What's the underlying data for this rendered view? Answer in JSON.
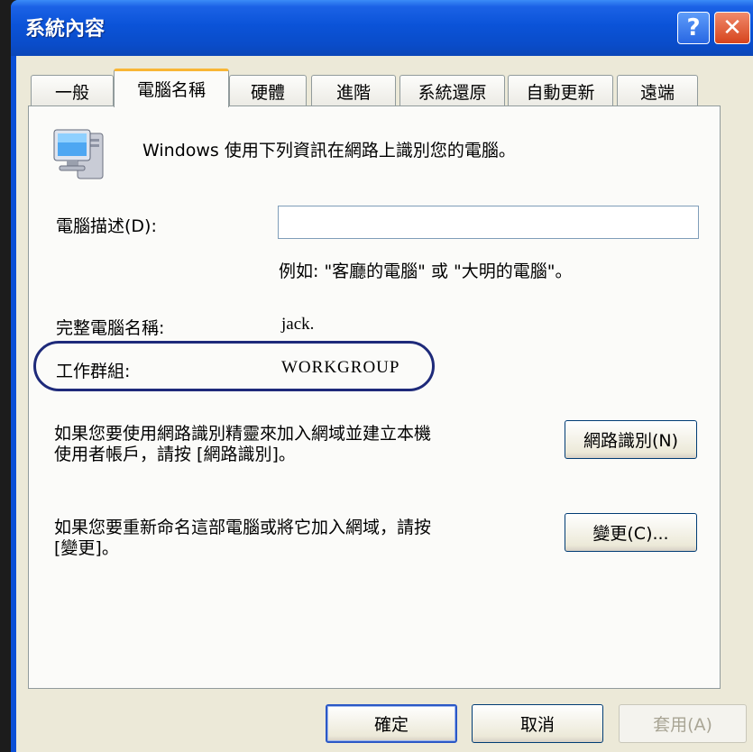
{
  "window": {
    "title": "系統內容",
    "help_label": "?",
    "close_label": "✕"
  },
  "tabs": [
    {
      "label": "一般"
    },
    {
      "label": "電腦名稱",
      "active": true
    },
    {
      "label": "硬體"
    },
    {
      "label": "進階"
    },
    {
      "label": "系統還原"
    },
    {
      "label": "自動更新"
    },
    {
      "label": "遠端"
    }
  ],
  "computer_name_page": {
    "intro": "Windows 使用下列資訊在網路上識別您的電腦。",
    "description_label": "電腦描述(D):",
    "description_value": "",
    "example_text": "例如: \"客廳的電腦\" 或 \"大明的電腦\"。",
    "full_name_label": "完整電腦名稱:",
    "full_name_value": "jack.",
    "workgroup_label": "工作群組:",
    "workgroup_value": "WORKGROUP",
    "network_id_text_line1": "如果您要使用網路識別精靈來加入網域並建立本機",
    "network_id_text_line2": "使用者帳戶，請按 [網路識別]。",
    "network_id_button": "網路識別(N)",
    "change_text_line1": "如果您要重新命名這部電腦或將它加入網域，請按",
    "change_text_line2": "[變更]。",
    "change_button": "變更(C)..."
  },
  "footer": {
    "ok_button": "確定",
    "cancel_button": "取消",
    "apply_button": "套用(A)"
  },
  "icons": {
    "computer": "computer-monitor-icon"
  },
  "colors": {
    "titlebar": "#0a4cc9",
    "dialog_bg": "#ece9d8",
    "highlight_oval": "#1e2a7a"
  }
}
